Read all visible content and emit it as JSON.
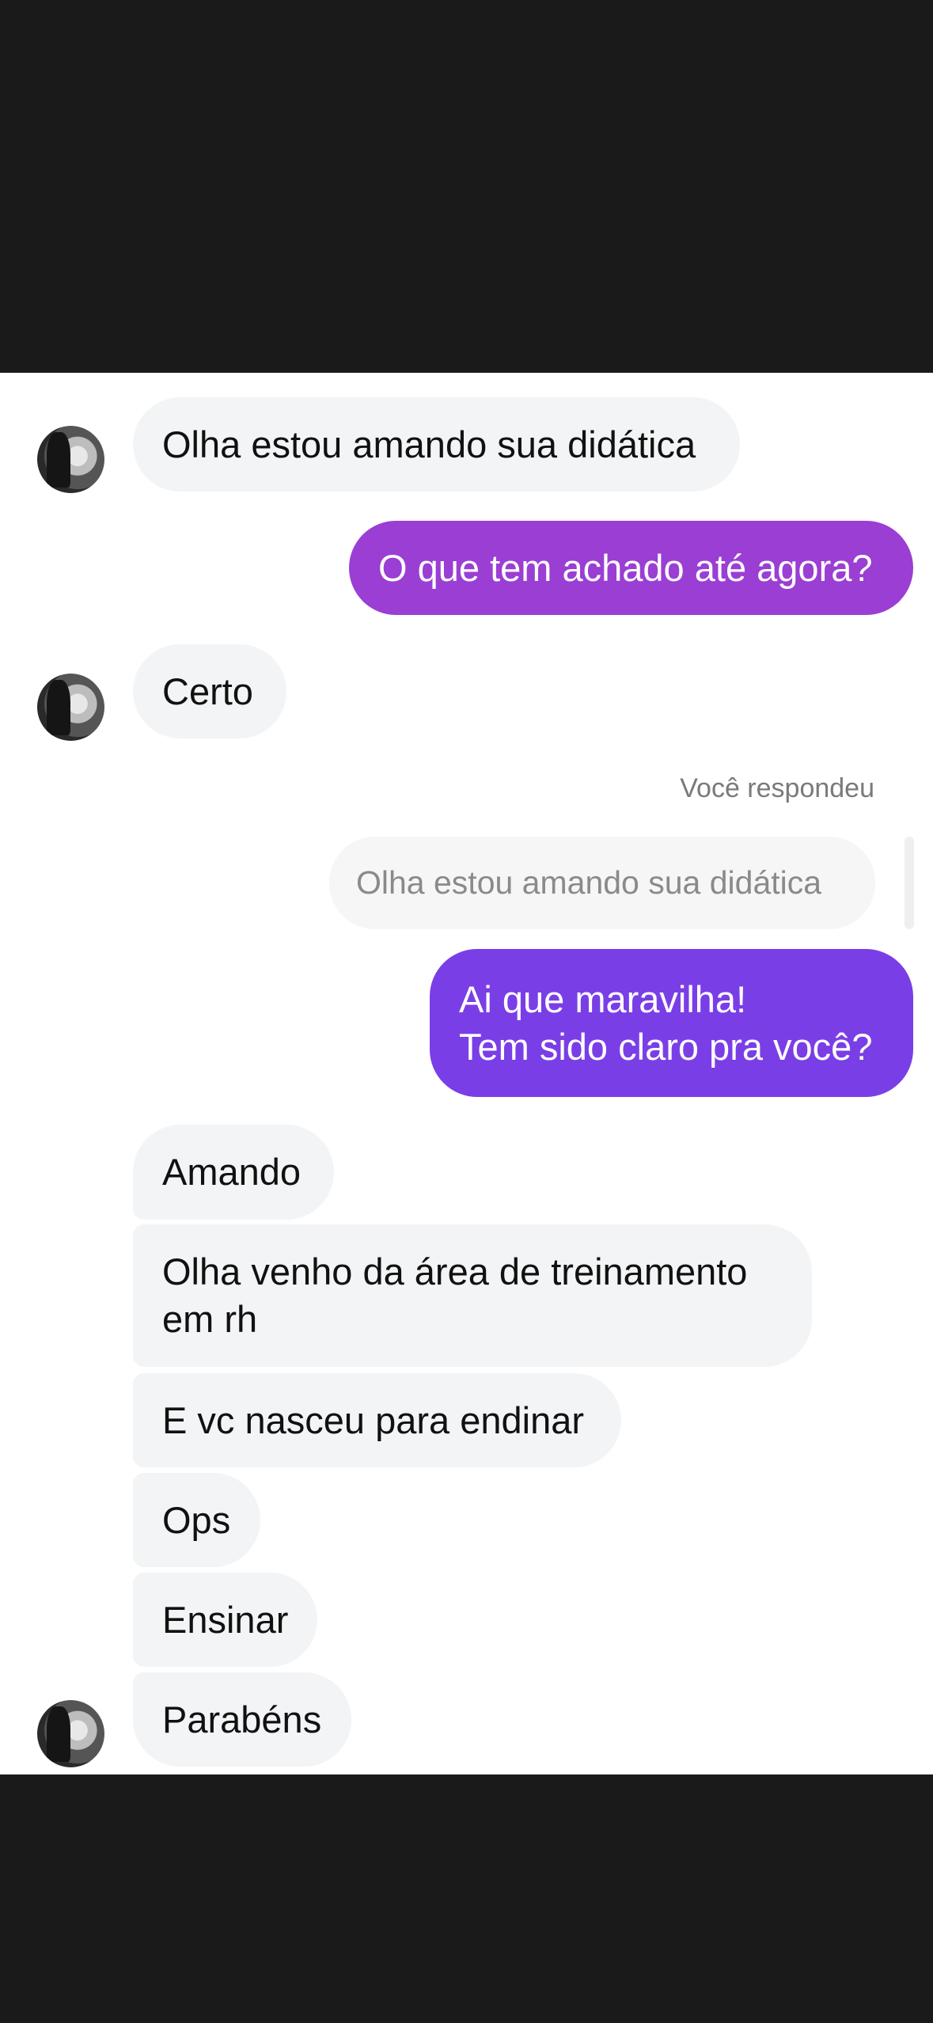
{
  "messages": {
    "m1": "Olha estou amando sua didática",
    "m2": "O que tem achado até agora?",
    "m3": "Certo",
    "reply_label": "Você respondeu",
    "quoted": "Olha estou amando sua didática",
    "m4_line1": "Ai que maravilha!",
    "m4_line2": "Tem sido claro pra você?",
    "m5": "Amando",
    "m6_line1": "Olha venho da área de treinamento",
    "m6_line2": "em rh",
    "m7": "E vc nasceu para endinar",
    "m8": "Ops",
    "m9": "Ensinar",
    "m10": "Parabéns"
  },
  "colors": {
    "outgoing_1": "#9b3ed4",
    "outgoing_2": "#7a3ee6",
    "incoming": "#f3f4f6",
    "background": "#ffffff",
    "frame": "#1a1a1a"
  }
}
